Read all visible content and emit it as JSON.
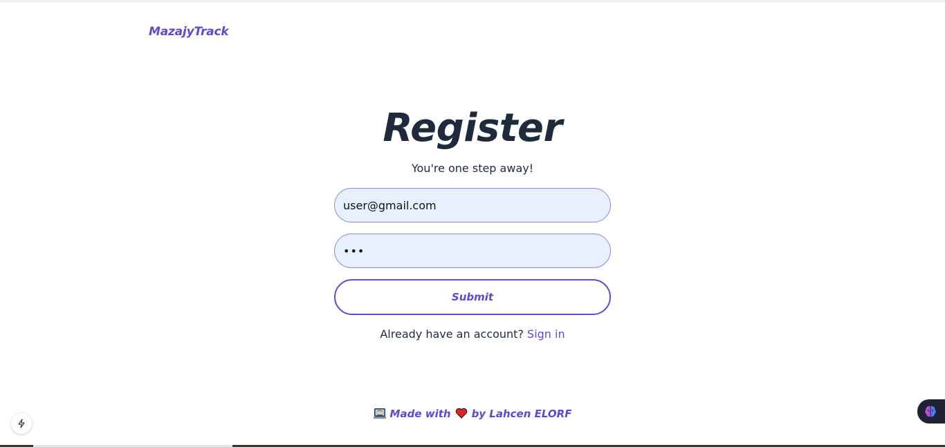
{
  "brand": {
    "name": "MazajyTrack",
    "color": "#5a4ad6"
  },
  "register": {
    "title": "Register",
    "subtitle": "You're one step away!",
    "email_value": "user@gmail.com",
    "password_value": "•••",
    "submit_label": "Submit"
  },
  "signin": {
    "prompt": "Already have an account?",
    "link_label": "Sign in"
  },
  "footer": {
    "made_with": "Made with",
    "by": "by Lahcen ELORF",
    "icons": [
      "technologist-emoji",
      "red-heart-emoji"
    ]
  },
  "widgets": {
    "left_icon": "lightning-bolt-icon",
    "right_icon": "brain-icon"
  },
  "colors": {
    "accent": "#5a4ad6",
    "heading": "#1f2a3d",
    "input_bg": "#e8effd",
    "input_border": "#8e86e0"
  }
}
